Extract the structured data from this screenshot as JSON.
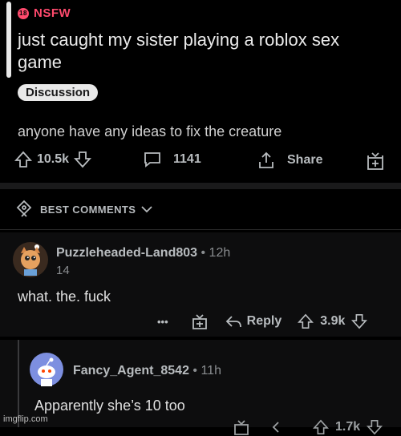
{
  "post": {
    "nsfw_label": "NSFW",
    "nsfw_badge": "18",
    "title": "just caught my sister playing a roblox sex game",
    "flair": "Discussion",
    "body": "anyone have any ideas to fix the creature",
    "upvotes": "10.5k",
    "comments": "1141",
    "share_label": "Share"
  },
  "sort": {
    "label": "BEST COMMENTS"
  },
  "comments": [
    {
      "username": "Puzzleheaded-Land803",
      "age": "12h",
      "score": "14",
      "text": "what. the. fuck",
      "more": "•••",
      "reply_label": "Reply",
      "votes": "3.9k"
    },
    {
      "username": "Fancy_Agent_8542",
      "age": "11h",
      "text": "Apparently she’s 10 too",
      "votes": "1.7k"
    }
  ],
  "watermark": "imgflip.com",
  "colors": {
    "nsfw": "#ff4a6d",
    "background": "#000000",
    "text": "#d7dadc"
  }
}
